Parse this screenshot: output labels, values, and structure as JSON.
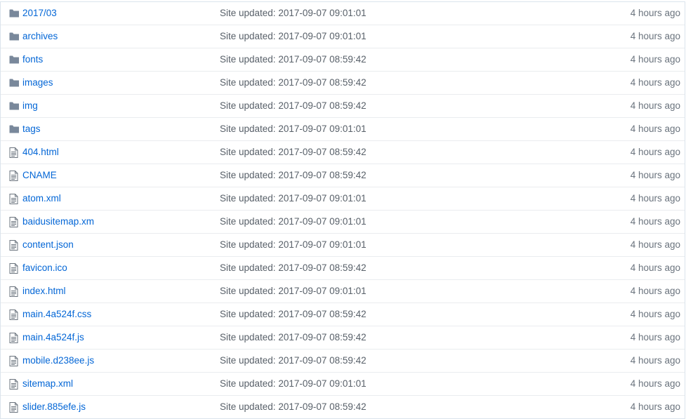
{
  "colors": {
    "link": "#0366d6",
    "message": "#586069",
    "age": "#6a737d",
    "folder_icon": "#79889b",
    "file_icon": "#6a737d",
    "row_border": "#eaecef"
  },
  "files": [
    {
      "type": "folder",
      "icon": "folder-icon",
      "name": "2017/03",
      "message": "Site updated: 2017-09-07 09:01:01",
      "age": "4 hours ago"
    },
    {
      "type": "folder",
      "icon": "folder-icon",
      "name": "archives",
      "message": "Site updated: 2017-09-07 09:01:01",
      "age": "4 hours ago"
    },
    {
      "type": "folder",
      "icon": "folder-icon",
      "name": "fonts",
      "message": "Site updated: 2017-09-07 08:59:42",
      "age": "4 hours ago"
    },
    {
      "type": "folder",
      "icon": "folder-icon",
      "name": "images",
      "message": "Site updated: 2017-09-07 08:59:42",
      "age": "4 hours ago"
    },
    {
      "type": "folder",
      "icon": "folder-icon",
      "name": "img",
      "message": "Site updated: 2017-09-07 08:59:42",
      "age": "4 hours ago"
    },
    {
      "type": "folder",
      "icon": "folder-icon",
      "name": "tags",
      "message": "Site updated: 2017-09-07 09:01:01",
      "age": "4 hours ago"
    },
    {
      "type": "file",
      "icon": "file-icon",
      "name": "404.html",
      "message": "Site updated: 2017-09-07 08:59:42",
      "age": "4 hours ago"
    },
    {
      "type": "file",
      "icon": "file-icon",
      "name": "CNAME",
      "message": "Site updated: 2017-09-07 08:59:42",
      "age": "4 hours ago"
    },
    {
      "type": "file",
      "icon": "file-icon",
      "name": "atom.xml",
      "message": "Site updated: 2017-09-07 09:01:01",
      "age": "4 hours ago"
    },
    {
      "type": "file",
      "icon": "file-icon",
      "name": "baidusitemap.xm",
      "message": "Site updated: 2017-09-07 09:01:01",
      "age": "4 hours ago"
    },
    {
      "type": "file",
      "icon": "file-icon",
      "name": "content.json",
      "message": "Site updated: 2017-09-07 09:01:01",
      "age": "4 hours ago"
    },
    {
      "type": "file",
      "icon": "file-icon",
      "name": "favicon.ico",
      "message": "Site updated: 2017-09-07 08:59:42",
      "age": "4 hours ago"
    },
    {
      "type": "file",
      "icon": "file-icon",
      "name": "index.html",
      "message": "Site updated: 2017-09-07 09:01:01",
      "age": "4 hours ago"
    },
    {
      "type": "file",
      "icon": "file-icon",
      "name": "main.4a524f.css",
      "message": "Site updated: 2017-09-07 08:59:42",
      "age": "4 hours ago"
    },
    {
      "type": "file",
      "icon": "file-icon",
      "name": "main.4a524f.js",
      "message": "Site updated: 2017-09-07 08:59:42",
      "age": "4 hours ago"
    },
    {
      "type": "file",
      "icon": "file-icon",
      "name": "mobile.d238ee.js",
      "message": "Site updated: 2017-09-07 08:59:42",
      "age": "4 hours ago"
    },
    {
      "type": "file",
      "icon": "file-icon",
      "name": "sitemap.xml",
      "message": "Site updated: 2017-09-07 09:01:01",
      "age": "4 hours ago"
    },
    {
      "type": "file",
      "icon": "file-icon",
      "name": "slider.885efe.js",
      "message": "Site updated: 2017-09-07 08:59:42",
      "age": "4 hours ago"
    }
  ]
}
